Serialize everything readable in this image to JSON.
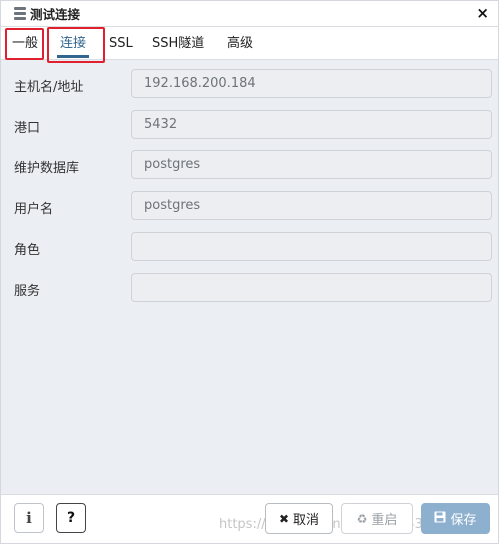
{
  "dialog": {
    "title": "测试连接",
    "close_label": "×"
  },
  "tabs": [
    {
      "label": "一般"
    },
    {
      "label": "连接",
      "active": true
    },
    {
      "label": "SSL"
    },
    {
      "label": "SSH隧道"
    },
    {
      "label": "高级"
    }
  ],
  "form": {
    "host": {
      "label": "主机名/地址",
      "value": "192.168.200.184"
    },
    "port": {
      "label": "港口",
      "value": "5432"
    },
    "maintenance_db": {
      "label": "维护数据库",
      "value": "postgres"
    },
    "username": {
      "label": "用户名",
      "value": "postgres"
    },
    "role": {
      "label": "角色",
      "value": ""
    },
    "service": {
      "label": "服务",
      "value": ""
    }
  },
  "footer": {
    "info_label": "i",
    "help_label": "?",
    "cancel_label": "取消",
    "cancel_glyph": "✖",
    "reset_label": "重启",
    "reset_glyph": "♻",
    "save_label": "保存",
    "save_glyph": "💾"
  },
  "watermark": "https://blog.csdn.net/weixin_43...578",
  "colors": {
    "accent": "#326690",
    "highlight": "#e0202e",
    "save_button": "#8eb0cf"
  }
}
